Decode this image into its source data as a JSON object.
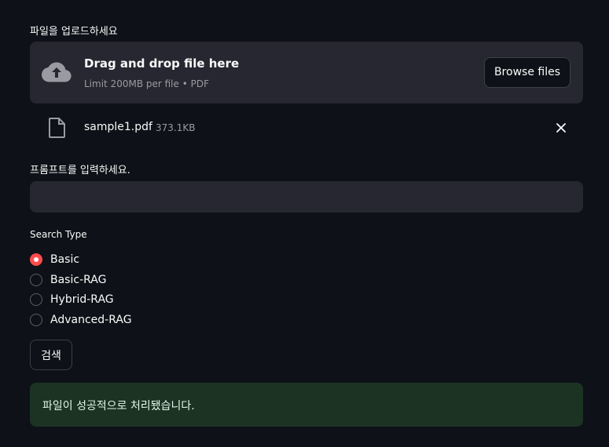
{
  "uploader": {
    "label": "파일을 업로드하세요",
    "drop_title": "Drag and drop file here",
    "drop_subtitle": "Limit 200MB per file • PDF",
    "browse_label": "Browse files",
    "icon": "cloud-upload-icon"
  },
  "file": {
    "name": "sample1.pdf",
    "size": "373.1KB",
    "icon": "file-icon",
    "remove_icon": "close-icon"
  },
  "prompt": {
    "label": "프롬프트를 입력하세요.",
    "value": "",
    "placeholder": ""
  },
  "search_type": {
    "label": "Search Type",
    "options": [
      "Basic",
      "Basic-RAG",
      "Hybrid-RAG",
      "Advanced-RAG"
    ],
    "selected": "Basic"
  },
  "search_button": {
    "label": "검색"
  },
  "status": {
    "message": "파일이 성공적으로 처리됐습니다."
  },
  "colors": {
    "background": "#0e1117",
    "panel": "#262730",
    "accent": "#ff4b4b",
    "success_bg": "#1c3324",
    "success_text": "#dff7e6"
  }
}
